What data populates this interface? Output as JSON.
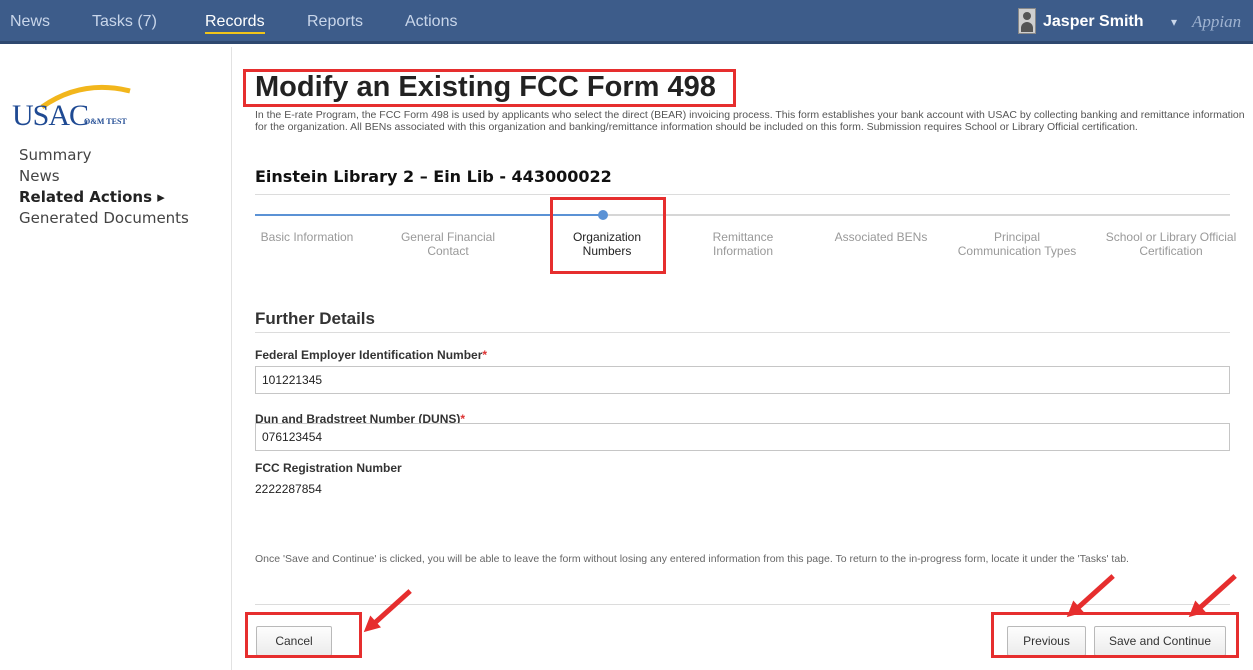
{
  "nav": {
    "items": [
      "News",
      "Tasks (7)",
      "Records",
      "Reports",
      "Actions"
    ],
    "active": "Records",
    "user_name": "Jasper Smith",
    "user_caret": "▾",
    "brand": "Appian"
  },
  "sidebar": {
    "logo_text": "USAC",
    "logo_sub": "O&M TEST",
    "links": [
      "Summary",
      "News",
      "Related Actions ▸",
      "Generated Documents"
    ]
  },
  "main": {
    "title": "Modify an Existing FCC Form 498",
    "intro": "In the E-rate Program, the FCC Form 498 is used by applicants who select the direct (BEAR) invoicing process. This form establishes your bank account with USAC by collecting banking and remittance information for the organization. All BENs associated with this organization and banking/remittance information should be included on this form. Submission requires School or Library Official certification.",
    "organization": "Einstein Library 2 – Ein Lib - 443000022",
    "steps": [
      "Basic Information",
      "General Financial Contact",
      "Organization Numbers",
      "Remittance Information",
      "Associated BENs",
      "Principal Communication Types",
      "School or Library Official Certification"
    ],
    "current_step": "Organization Numbers",
    "section_title": "Further Details",
    "fields": {
      "fein_label": "Federal Employer Identification Number",
      "fein_value": "101221345",
      "duns_label": "Dun and Bradstreet Number (DUNS)",
      "duns_value": "076123454",
      "frn_label": "FCC Registration Number",
      "frn_value": "2222287854",
      "required_mark": "*"
    },
    "footer_note": "Once 'Save and Continue' is clicked, you will be able to leave the form without losing any entered information from this page. To return to the in-progress form, locate it under the 'Tasks' tab.",
    "buttons": {
      "cancel": "Cancel",
      "previous": "Previous",
      "save_continue": "Save and Continue"
    }
  },
  "colors": {
    "nav_bg": "#3d5c8a",
    "accent": "#5b92d5",
    "highlight_red": "#e62e2e",
    "nav_active_underline": "#f0c419"
  }
}
